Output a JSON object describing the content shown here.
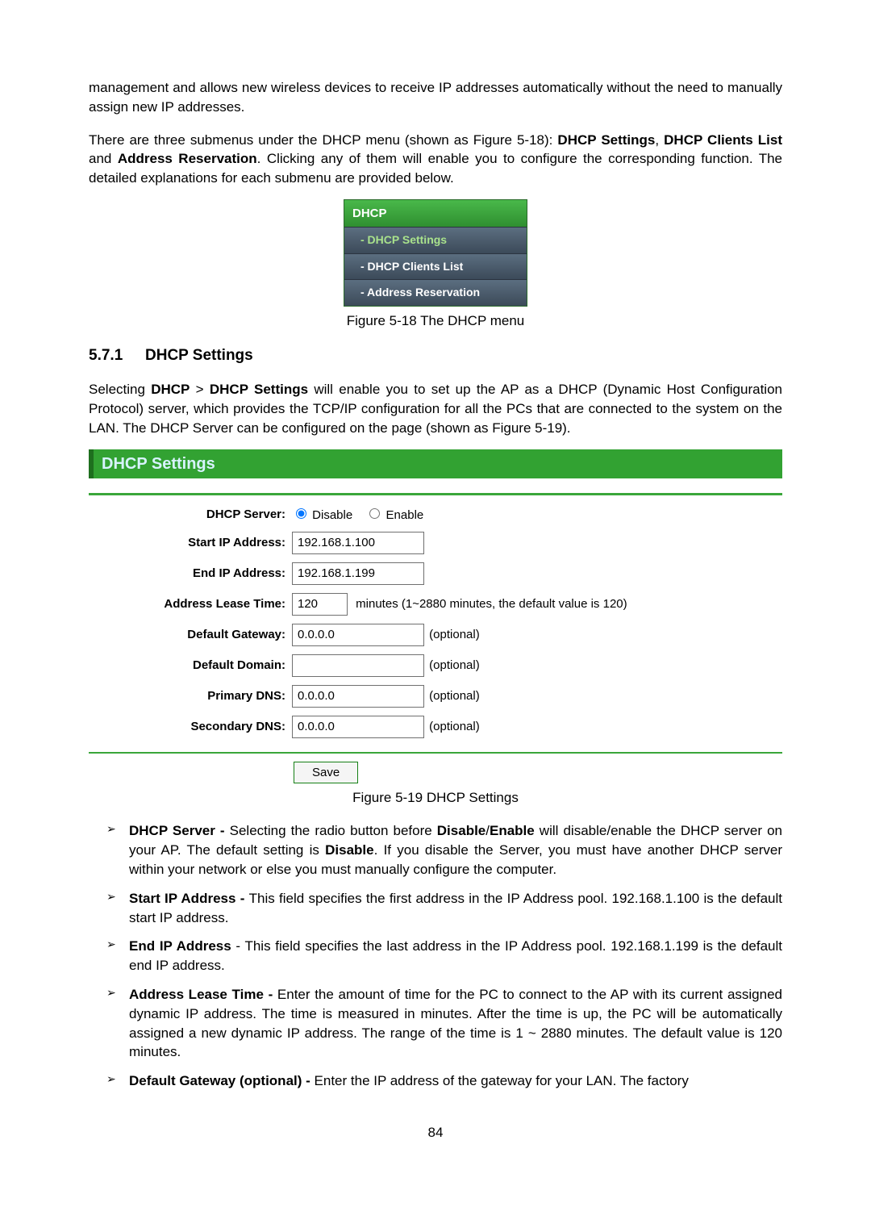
{
  "intro": {
    "p1": "management and allows new wireless devices to receive IP addresses automatically without the need to manually assign new IP addresses.",
    "p2_a": "There are three submenus under the DHCP menu (shown as Figure 5-18): ",
    "p2_b1": "DHCP Settings",
    "p2_c": ", ",
    "p2_b2": "DHCP Clients List",
    "p2_d": " and ",
    "p2_b3": "Address Reservation",
    "p2_e": ". Clicking any of them will enable you to configure the corresponding function. The detailed explanations for each submenu are provided below."
  },
  "menu": {
    "title": "DHCP",
    "items": [
      {
        "label": "- DHCP Settings",
        "active": true
      },
      {
        "label": "- DHCP Clients List",
        "active": false
      },
      {
        "label": "- Address Reservation",
        "active": false
      }
    ]
  },
  "fig18_caption": "Figure 5-18 The DHCP menu",
  "section": {
    "number": "5.7.1",
    "title": "DHCP Settings"
  },
  "section_p": {
    "a": "Selecting ",
    "b1": "DHCP",
    "gt": " > ",
    "b2": "DHCP Settings",
    "c": " will enable you to set up the AP as a DHCP (Dynamic Host Configuration Protocol) server, which provides the TCP/IP configuration for all the PCs that are connected to the system on the LAN. The DHCP Server can be configured on the page (shown as Figure 5-19)."
  },
  "panel": {
    "title": "DHCP Settings",
    "labels": {
      "server": "DHCP Server:",
      "start_ip": "Start IP Address:",
      "end_ip": "End IP Address:",
      "lease": "Address Lease Time:",
      "gateway": "Default Gateway:",
      "domain": "Default Domain:",
      "pdns": "Primary DNS:",
      "sdns": "Secondary DNS:"
    },
    "values": {
      "disable": "Disable",
      "enable": "Enable",
      "selected": "disable",
      "start_ip": "192.168.1.100",
      "end_ip": "192.168.1.199",
      "lease": "120",
      "lease_note": "minutes (1~2880 minutes, the default value is 120)",
      "gateway": "0.0.0.0",
      "domain": "",
      "pdns": "0.0.0.0",
      "sdns": "0.0.0.0",
      "optional": "(optional)"
    },
    "save": "Save"
  },
  "fig19_caption": "Figure 5-19 DHCP Settings",
  "bullets": [
    {
      "b": "DHCP Server - ",
      "t1": "Selecting the radio button before ",
      "b2": "Disable",
      "sep1": "/",
      "b3": "Enable",
      "t2": " will disable/enable the DHCP server on your AP. The default setting is ",
      "b4": "Disable",
      "t3": ". If you disable the Server, you must have another DHCP server within your network or else you must manually configure the computer."
    },
    {
      "b": "Start IP Address - ",
      "t": "This field specifies the first address in the IP Address pool. 192.168.1.100 is the default start IP address."
    },
    {
      "b": "End IP Address",
      "sep": " - ",
      "t": "This field specifies the last address in the IP Address pool. 192.168.1.199 is the default end IP address."
    },
    {
      "b": "Address Lease Time - ",
      "t": "Enter the amount of time for the PC to connect to the AP with its current assigned dynamic IP address. The time is measured in minutes. After the time is up, the PC will be automatically assigned a new dynamic IP address. The range of the time is 1 ~ 2880 minutes. The default value is 120 minutes."
    },
    {
      "b": "Default Gateway (optional) - ",
      "t": "Enter the IP address of the gateway for your LAN. The factory"
    }
  ],
  "page_number": "84"
}
